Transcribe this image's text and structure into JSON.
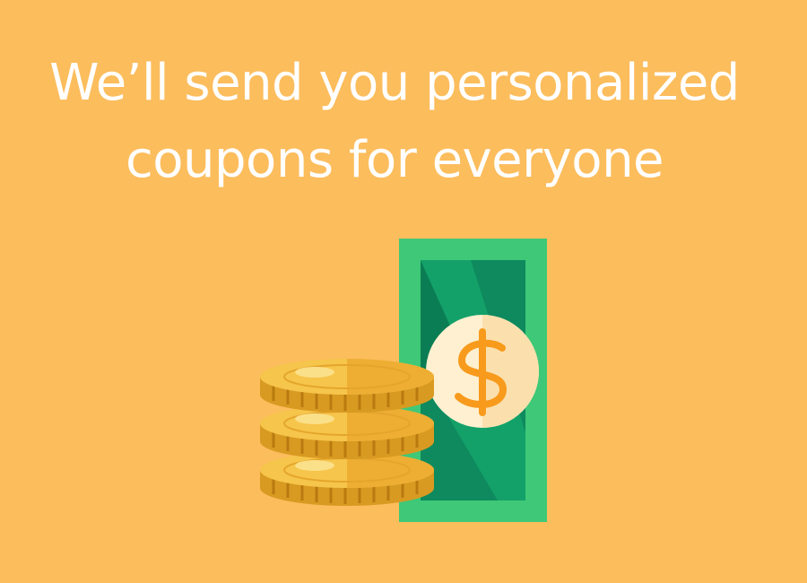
{
  "headline": {
    "line1": "We’ll send you personalized",
    "line2": "coupons for everyone"
  },
  "illustration": {
    "icons": [
      "dollar-bill-icon",
      "dollar-sign-icon",
      "coin-stack-icon"
    ],
    "colors": {
      "background": "#FCBD5D",
      "bill_border": "#3FC877",
      "bill_inner": "#0E8A5E",
      "bill_inner_light": "#13A169",
      "medallion": "#FEF0D0",
      "medallion_shade": "#FBE0AE",
      "dollar_sign": "#F89A1C",
      "coin_top": "#F6C54B",
      "coin_top_shade": "#EDAE33",
      "coin_edge": "#D99A22",
      "coin_ridge": "#B97A10"
    }
  }
}
